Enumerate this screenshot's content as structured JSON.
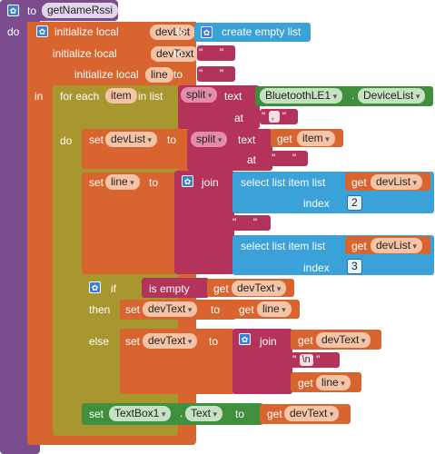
{
  "procedure": {
    "to": "to",
    "name": "getNameRssi",
    "do": "do"
  },
  "init_list": {
    "label": "initialize local",
    "var": "devList",
    "to": "to",
    "value": "create empty list"
  },
  "init_text": {
    "label": "initialize local",
    "var": "devText",
    "to": "to"
  },
  "init_line": {
    "label": "initialize local",
    "var": "line",
    "to": "to"
  },
  "in_label": "in",
  "foreach": {
    "label": "for each",
    "var": "item",
    "in_list": "in list",
    "do": "do"
  },
  "split1": {
    "label": "split",
    "text": "text",
    "comp": "BluetoothLE1",
    "prop": "DeviceList",
    "at": "at",
    "sep": ","
  },
  "set_devlist": {
    "set": "set",
    "var": "devList",
    "to": "to",
    "split": "split",
    "text": "text",
    "get": "get",
    "get_var": "item",
    "at": "at",
    "sep": ""
  },
  "set_line": {
    "set": "set",
    "var": "line",
    "to": "to",
    "join": "join"
  },
  "select1": {
    "label": "select list item  list",
    "get": "get",
    "var": "devList",
    "index": "index",
    "index_val": "2"
  },
  "quote": "",
  "select2": {
    "label": "select list item  list",
    "get": "get",
    "var": "devList",
    "index": "index",
    "index_val": "3"
  },
  "if_block": {
    "if": "if",
    "is_empty": "is empty",
    "get": "get",
    "var": "devText",
    "then": "then",
    "else": "else"
  },
  "then_set": {
    "set": "set",
    "var": "devText",
    "to": "to",
    "get": "get",
    "get_var": "line"
  },
  "else_set": {
    "set": "set",
    "var": "devText",
    "to": "to",
    "join": "join",
    "get1": "get",
    "var1": "devText",
    "nl": "\\n",
    "get2": "get",
    "var2": "line"
  },
  "set_textbox": {
    "set": "set",
    "comp": "TextBox1",
    "prop": "Text",
    "to": "to",
    "get": "get",
    "var": "devText"
  },
  "colors": {
    "procedure": "#7b4d8e",
    "variables": "#d8652f",
    "control": "#a8962e",
    "text": "#b3335a",
    "lists": "#3aa1d9",
    "component": "#3f8f3c"
  },
  "icons": [
    "gear-icon"
  ]
}
